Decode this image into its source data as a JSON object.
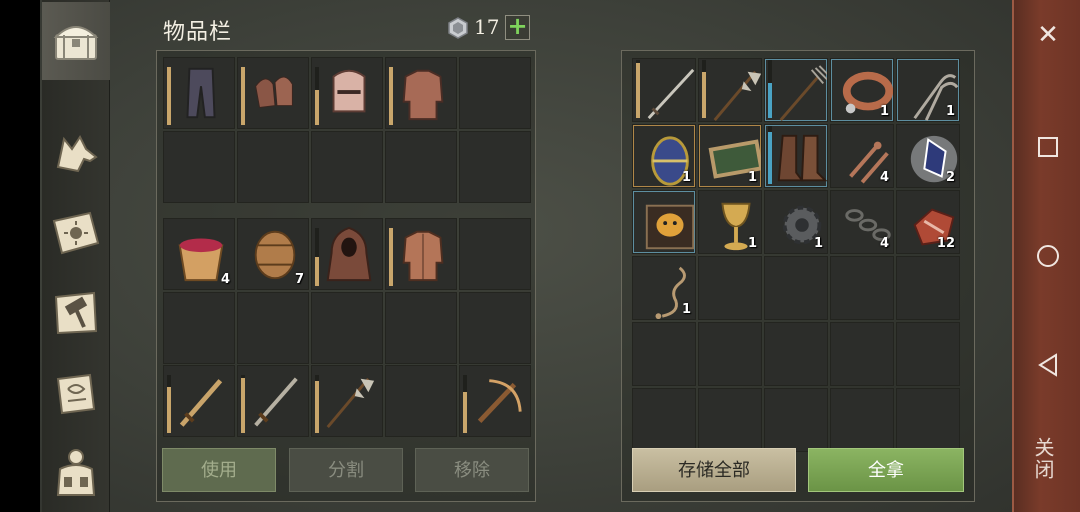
{
  "inventory": {
    "title": "物品栏",
    "gem_count": "17",
    "add_label": "+"
  },
  "tabs": [
    {
      "name": "chest-icon",
      "active": true
    },
    {
      "name": "wolf-icon",
      "active": false
    },
    {
      "name": "sun-book-icon",
      "active": false
    },
    {
      "name": "hammer-map-icon",
      "active": false
    },
    {
      "name": "scroll-icon",
      "active": false
    },
    {
      "name": "backpack-icon",
      "active": false
    }
  ],
  "equipment_grid": [
    {
      "item": "trousers-icon",
      "durability": 1.0,
      "dur_color": "#c9a66b"
    },
    {
      "item": "chainmail-gloves-icon",
      "durability": 1.0,
      "dur_color": "#c9a66b"
    },
    {
      "item": "great-helm-icon",
      "durability": 0.6,
      "dur_color": "#c9a66b"
    },
    {
      "item": "chainmail-shirt-icon",
      "durability": 1.0,
      "dur_color": "#c9a66b"
    },
    {},
    {},
    {},
    {},
    {},
    {}
  ],
  "bag_grid": [
    {
      "item": "berry-bucket-icon",
      "qty": "4"
    },
    {
      "item": "barrel-icon",
      "qty": "7"
    },
    {
      "item": "hood-cloak-icon",
      "durability": 0.5,
      "dur_color": "#c9a66b"
    },
    {
      "item": "padded-jacket-icon",
      "durability": 1.0,
      "dur_color": "#c9a66b"
    },
    {},
    {},
    {},
    {},
    {},
    {}
  ],
  "hotbar_grid": [
    {
      "item": "bronze-sword-icon",
      "durability": 0.8,
      "dur_color": "#c9a66b"
    },
    {
      "item": "iron-sword-icon",
      "durability": 0.95,
      "dur_color": "#c9a66b"
    },
    {
      "item": "halberd-icon",
      "durability": 0.9,
      "dur_color": "#c9a66b"
    },
    {},
    {
      "item": "crossbow-icon",
      "durability": 0.7,
      "dur_color": "#c9a66b"
    }
  ],
  "buttons": {
    "use": "使用",
    "split": "分割",
    "remove": "移除",
    "store_all": "存储全部",
    "take_all": "全拿"
  },
  "chest_grid": [
    {
      "item": "longsword-icon",
      "durability": 0.95,
      "dur_color": "#c9a66b"
    },
    {
      "item": "halberd-icon",
      "durability": 0.8,
      "dur_color": "#c9a66b"
    },
    {
      "item": "pitchfork-icon",
      "durability": 0.6,
      "dur_color": "#4aa3c4",
      "frame": "blue"
    },
    {
      "item": "dog-collar-icon",
      "qty": "1",
      "frame": "blue"
    },
    {
      "item": "pincers-icon",
      "qty": "1",
      "frame": "blue"
    },
    {
      "item": "decorated-egg-icon",
      "qty": "1",
      "frame": "orange"
    },
    {
      "item": "framed-mirror-icon",
      "qty": "1",
      "frame": "orange"
    },
    {
      "item": "leather-boots-icon",
      "durability": 0.9,
      "dur_color": "#4aa3c4",
      "frame": "blue"
    },
    {
      "item": "nails-icon",
      "qty": "4"
    },
    {
      "item": "crystal-shard-icon",
      "qty": "2"
    },
    {
      "item": "mask-book-icon",
      "frame": "blue"
    },
    {
      "item": "golden-goblet-icon",
      "qty": "1"
    },
    {
      "item": "gear-part-icon",
      "qty": "1"
    },
    {
      "item": "iron-chain-icon",
      "qty": "4"
    },
    {
      "item": "meat-chunks-icon",
      "qty": "12"
    },
    {
      "item": "rope-icon",
      "qty": "1"
    },
    {},
    {},
    {},
    {},
    {},
    {},
    {},
    {},
    {},
    {},
    {},
    {},
    {},
    {}
  ],
  "system_nav": {
    "close_x": "✕",
    "close_label": "关闭"
  }
}
